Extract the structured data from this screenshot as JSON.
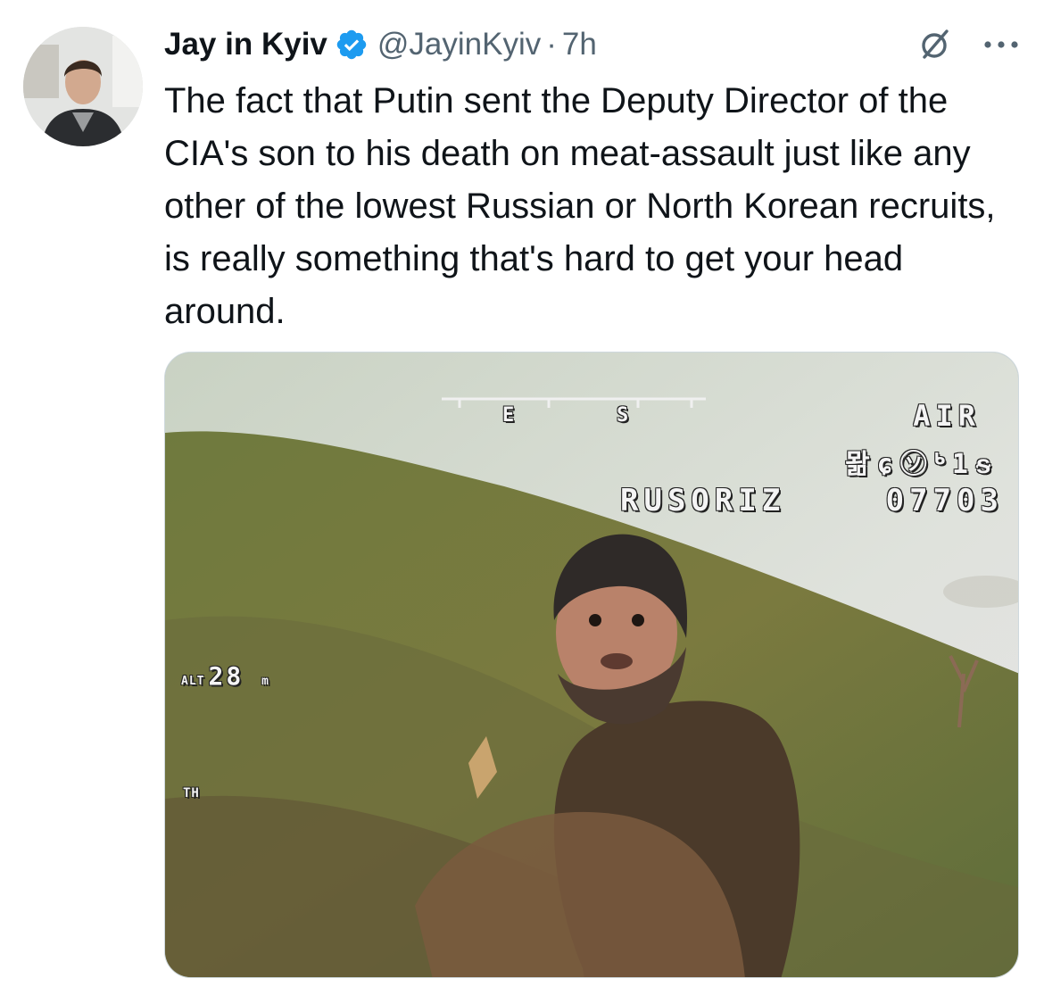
{
  "tweet": {
    "display_name": "Jay in Kyiv",
    "handle": "@JayinKyiv",
    "separator": "·",
    "time": "7h",
    "text": "The fact that Putin sent the Deputy Director of the CIA's son to his death on meat-assault just like any other of the lowest Russian or North Korean recruits, is really something that's hard to get your head around."
  },
  "icons": {
    "verified": "verified-badge-icon",
    "grok": "grok-icon",
    "more": "more-options-icon"
  },
  "colors": {
    "verified": "#1d9bf0",
    "secondary_text": "#536471",
    "primary_text": "#0f1419"
  },
  "media": {
    "osd_air": "AIR",
    "osd_garble": "뫎ɕ㋞ᒃ1ᵴ",
    "osd_callsign": "RUSORIZ",
    "osd_code": "07703",
    "osd_alt_label": "ALT",
    "osd_alt_value": "28",
    "osd_alt_unit": "m",
    "osd_th_label": "TH",
    "compass_e": "E",
    "compass_s": "S"
  }
}
